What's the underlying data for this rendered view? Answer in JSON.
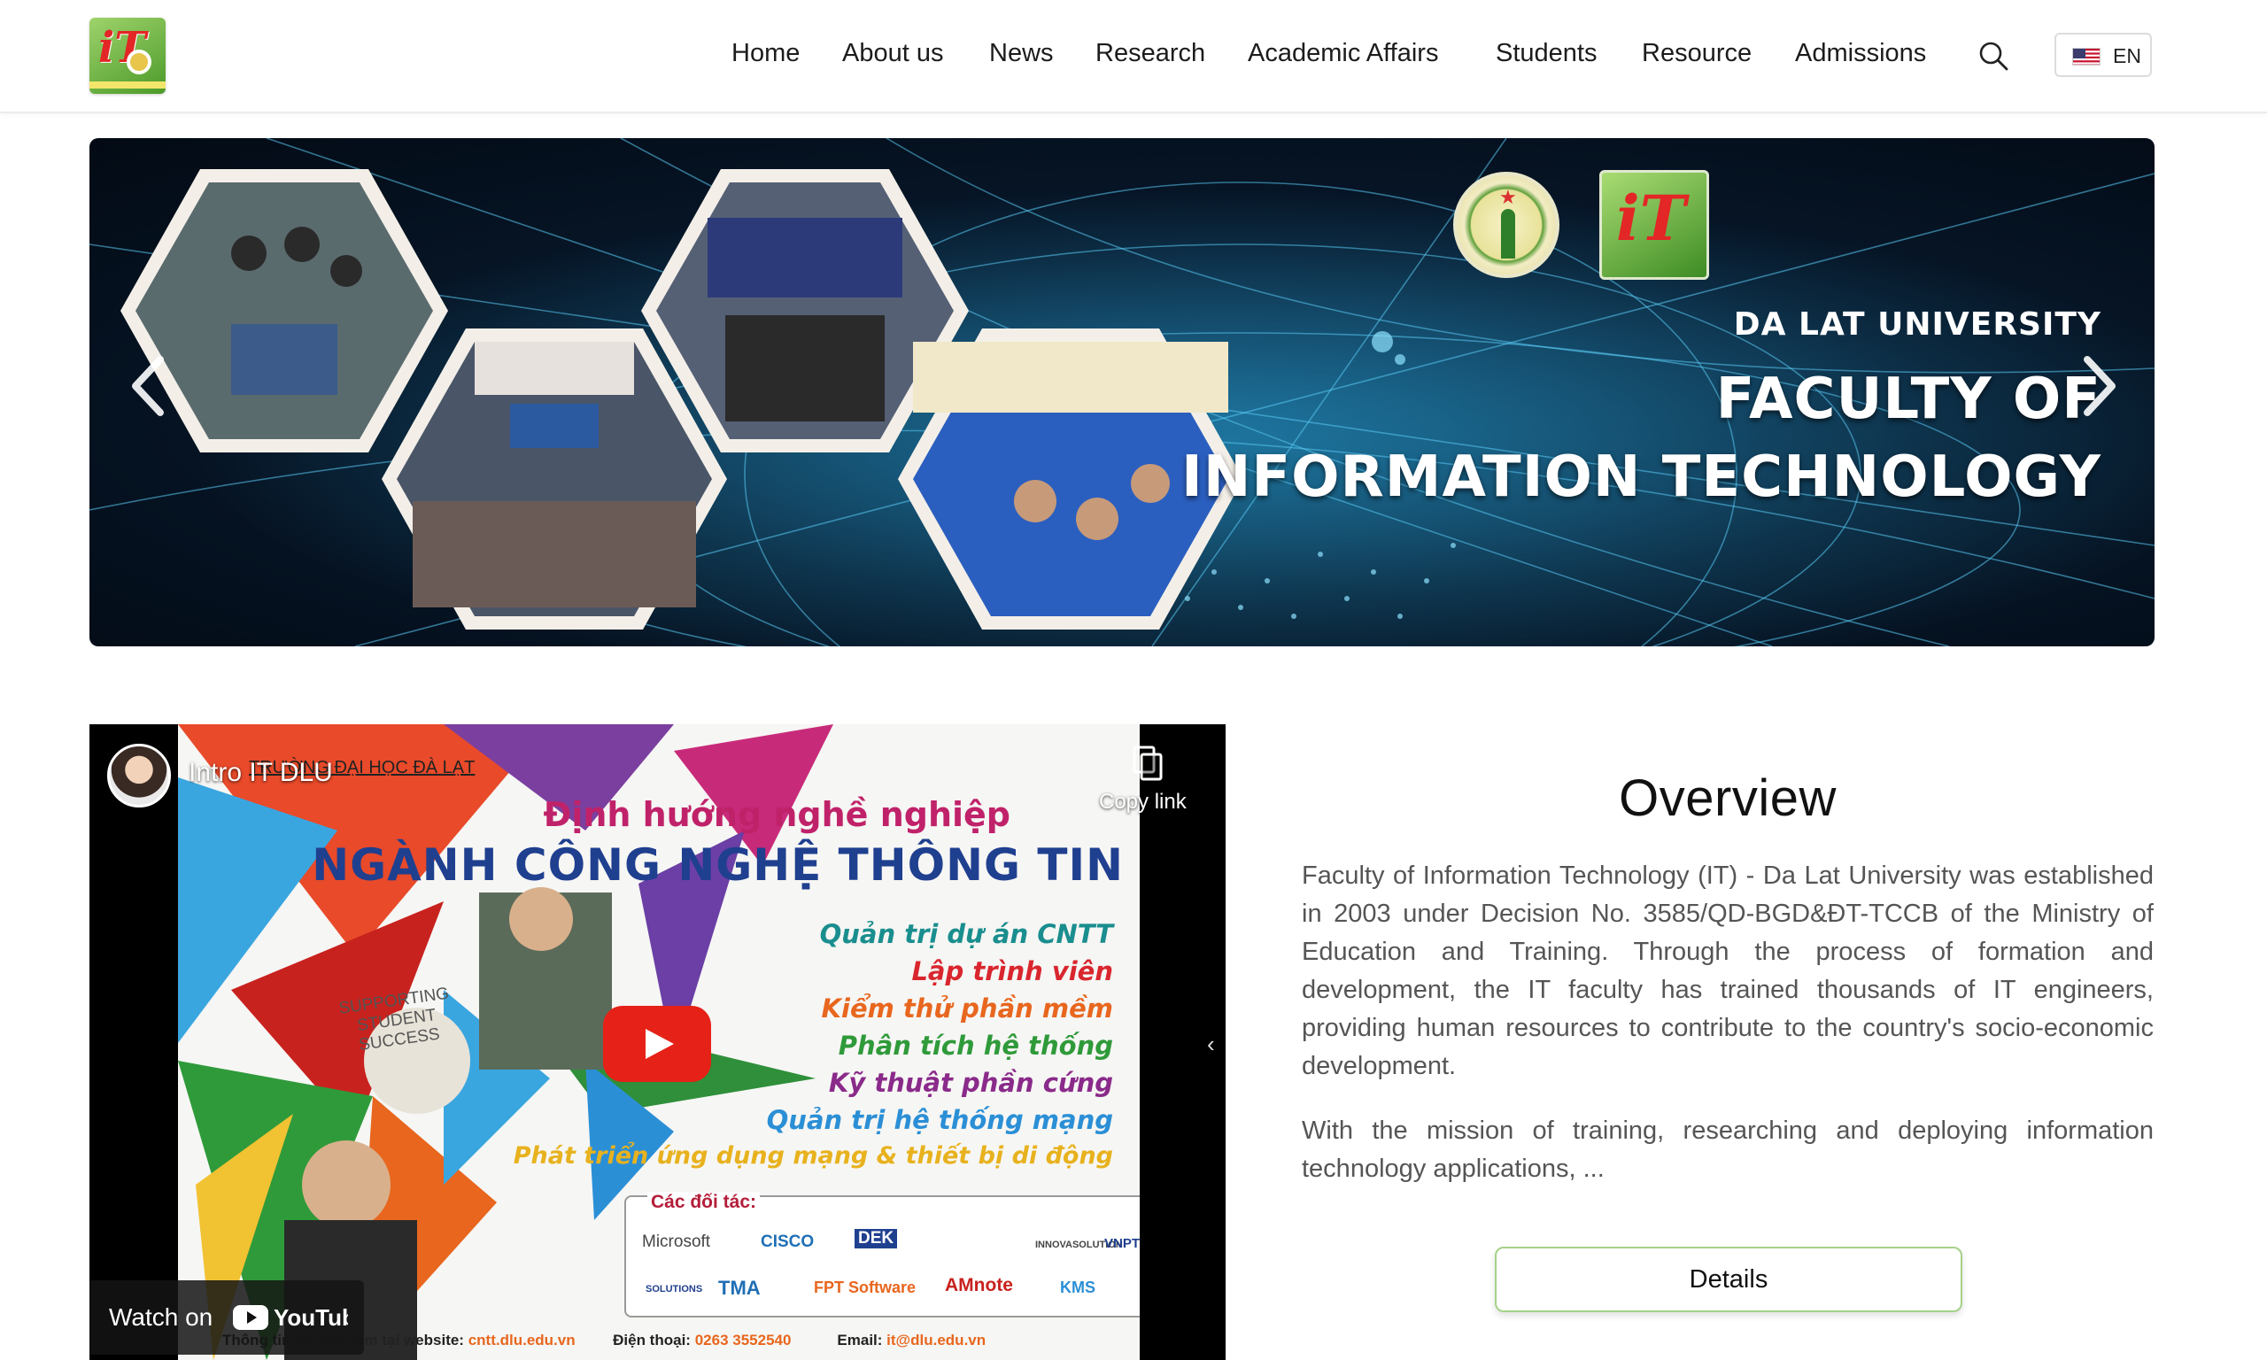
{
  "header": {
    "nav": [
      {
        "label": "Home"
      },
      {
        "label": "About us"
      },
      {
        "label": "News"
      },
      {
        "label": "Research"
      },
      {
        "label": "Academic Affairs"
      },
      {
        "label": "Students"
      },
      {
        "label": "Resource"
      },
      {
        "label": "Admissions"
      }
    ],
    "search_icon": "search-icon",
    "language": {
      "label": "EN",
      "flag_icon": "us-flag-icon"
    }
  },
  "banner": {
    "line1": "DA LAT UNIVERSITY",
    "line2": "FACULTY OF",
    "line3": "INFORMATION TECHNOLOGY",
    "prev_icon": "chevron-left-icon",
    "next_icon": "chevron-right-icon"
  },
  "video": {
    "title": "Intro IT DLU",
    "copy_label": "Copy link",
    "watch_on": "Watch on",
    "youtube_label": "YouTube",
    "poster": {
      "school": "TRƯỜNG ĐẠI HỌC ĐÀ LẠT",
      "heading1": "Định hướng nghề nghiệp",
      "heading2": "NGÀNH CÔNG NGHỆ THÔNG TIN",
      "careers": [
        {
          "text": "Quản trị dự án CNTT",
          "color": "#1a8e8e"
        },
        {
          "text": "Lập trình viên",
          "color": "#d9262e"
        },
        {
          "text": "Kiểm thử phần mềm",
          "color": "#e8661e"
        },
        {
          "text": "Phân tích hệ thống",
          "color": "#2f9a3a"
        },
        {
          "text": "Kỹ thuật phần cứng",
          "color": "#8a2a8a"
        },
        {
          "text": "Quản trị hệ thống mạng",
          "color": "#2b8fd6"
        },
        {
          "text": "Phát triển ứng dụng mạng & thiết bị di động",
          "color": "#e8b21e"
        }
      ],
      "supporting": "SUPPORTING STUDENT SUCCESS",
      "partners_title": "Các đối tác:",
      "partners": [
        "Microsoft",
        "CISCO",
        "DEK",
        "INNOVASOLUTION",
        "VNPT",
        "SOLUTIONS",
        "TMA",
        "FPT Software",
        "AMnote",
        "KMS"
      ],
      "website_label": "Thông tin chi tiết xem tại website:",
      "website": "cntt.dlu.edu.vn",
      "phone_label": "Điện thoại:",
      "phone": "0263 3552540",
      "email_label": "Email:",
      "email": "it@dlu.edu.vn"
    }
  },
  "overview": {
    "title": "Overview",
    "paragraph1": "Faculty of Information Technology (IT) - Da Lat University was established in 2003 under Decision No. 3585/QD-BGD&ĐT-TCCB of the Ministry of Education and Training. Through the process of formation and development, the IT faculty has trained thousands of IT engineers, providing human resources to contribute to the country's socio-economic development.",
    "paragraph2": "With the mission of training, researching and deploying information technology applications, ...",
    "details_label": "Details"
  },
  "colors": {
    "accent_green": "#a5d189",
    "text_gray": "#555555",
    "banner_bg": "#07182b"
  }
}
